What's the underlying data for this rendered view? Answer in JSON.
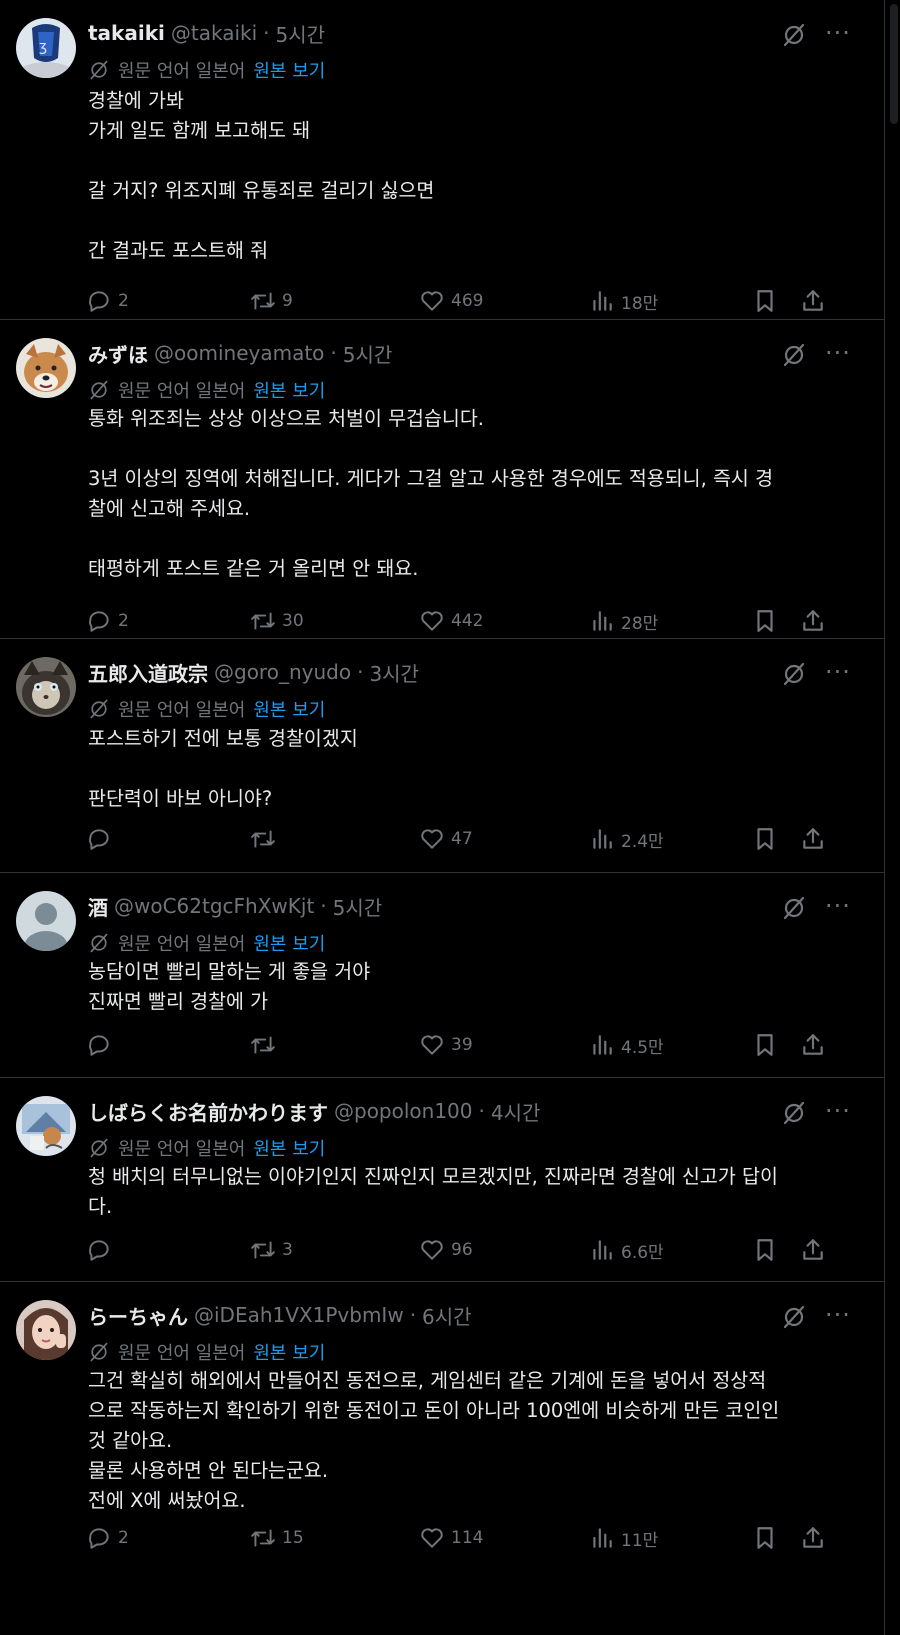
{
  "translate": {
    "label": "원문 언어 일본어",
    "link": "원본 보기"
  },
  "posts": [
    {
      "name": "takaiki",
      "handle": "@takaiki",
      "time": "5시간",
      "body": [
        "경찰에 가봐",
        "가게 일도 함께 보고해도 돼",
        "",
        "갈 거지? 위조지폐 유통죄로 걸리기 싫으면",
        "",
        "간 결과도 포스트해 줘"
      ],
      "replies": "2",
      "reposts": "9",
      "likes": "469",
      "views": "18만"
    },
    {
      "name": "みずほ",
      "handle": "@oomineyamato",
      "time": "5시간",
      "body": [
        "통화 위조죄는 상상 이상으로 처벌이 무겁습니다.",
        "",
        "3년 이상의 징역에 처해집니다. 게다가 그걸 알고 사용한 경우에도 적용되니, 즉시 경",
        "찰에 신고해 주세요.",
        "",
        "태평하게 포스트 같은 거 올리면 안 돼요."
      ],
      "replies": "2",
      "reposts": "30",
      "likes": "442",
      "views": "28만"
    },
    {
      "name": "五郎入道政宗",
      "handle": "@goro_nyudo",
      "time": "3시간",
      "body": [
        "포스트하기 전에 보통 경찰이겠지",
        "",
        "판단력이 바보 아니야?"
      ],
      "replies": "",
      "reposts": "",
      "likes": "47",
      "views": "2.4만"
    },
    {
      "name": "酒",
      "handle": "@woC62tgcFhXwKjt",
      "time": "5시간",
      "body": [
        "농담이면 빨리 말하는 게 좋을 거야",
        "진짜면 빨리 경찰에 가"
      ],
      "replies": "",
      "reposts": "",
      "likes": "39",
      "views": "4.5만"
    },
    {
      "name": "しばらくお名前かわります",
      "handle": "@popolon100",
      "time": "4시간",
      "body": [
        "청 배치의 터무니없는 이야기인지 진짜인지 모르겠지만, 진짜라면 경찰에 신고가 답이",
        "다."
      ],
      "replies": "",
      "reposts": "3",
      "likes": "96",
      "views": "6.6만"
    },
    {
      "name": "らーちゃん",
      "handle": "@iDEah1VX1PvbmIw",
      "time": "6시간",
      "body": [
        "그건 확실히 해외에서 만들어진 동전으로, 게임센터 같은 기계에 돈을 넣어서 정상적",
        "으로 작동하는지 확인하기 위한 동전이고 돈이 아니라 100엔에 비슷하게 만든 코인인",
        "것 같아요.",
        "물론 사용하면 안 된다는군요.",
        "전에 X에 써놨어요."
      ],
      "replies": "2",
      "reposts": "15",
      "likes": "114",
      "views": "11만"
    }
  ]
}
